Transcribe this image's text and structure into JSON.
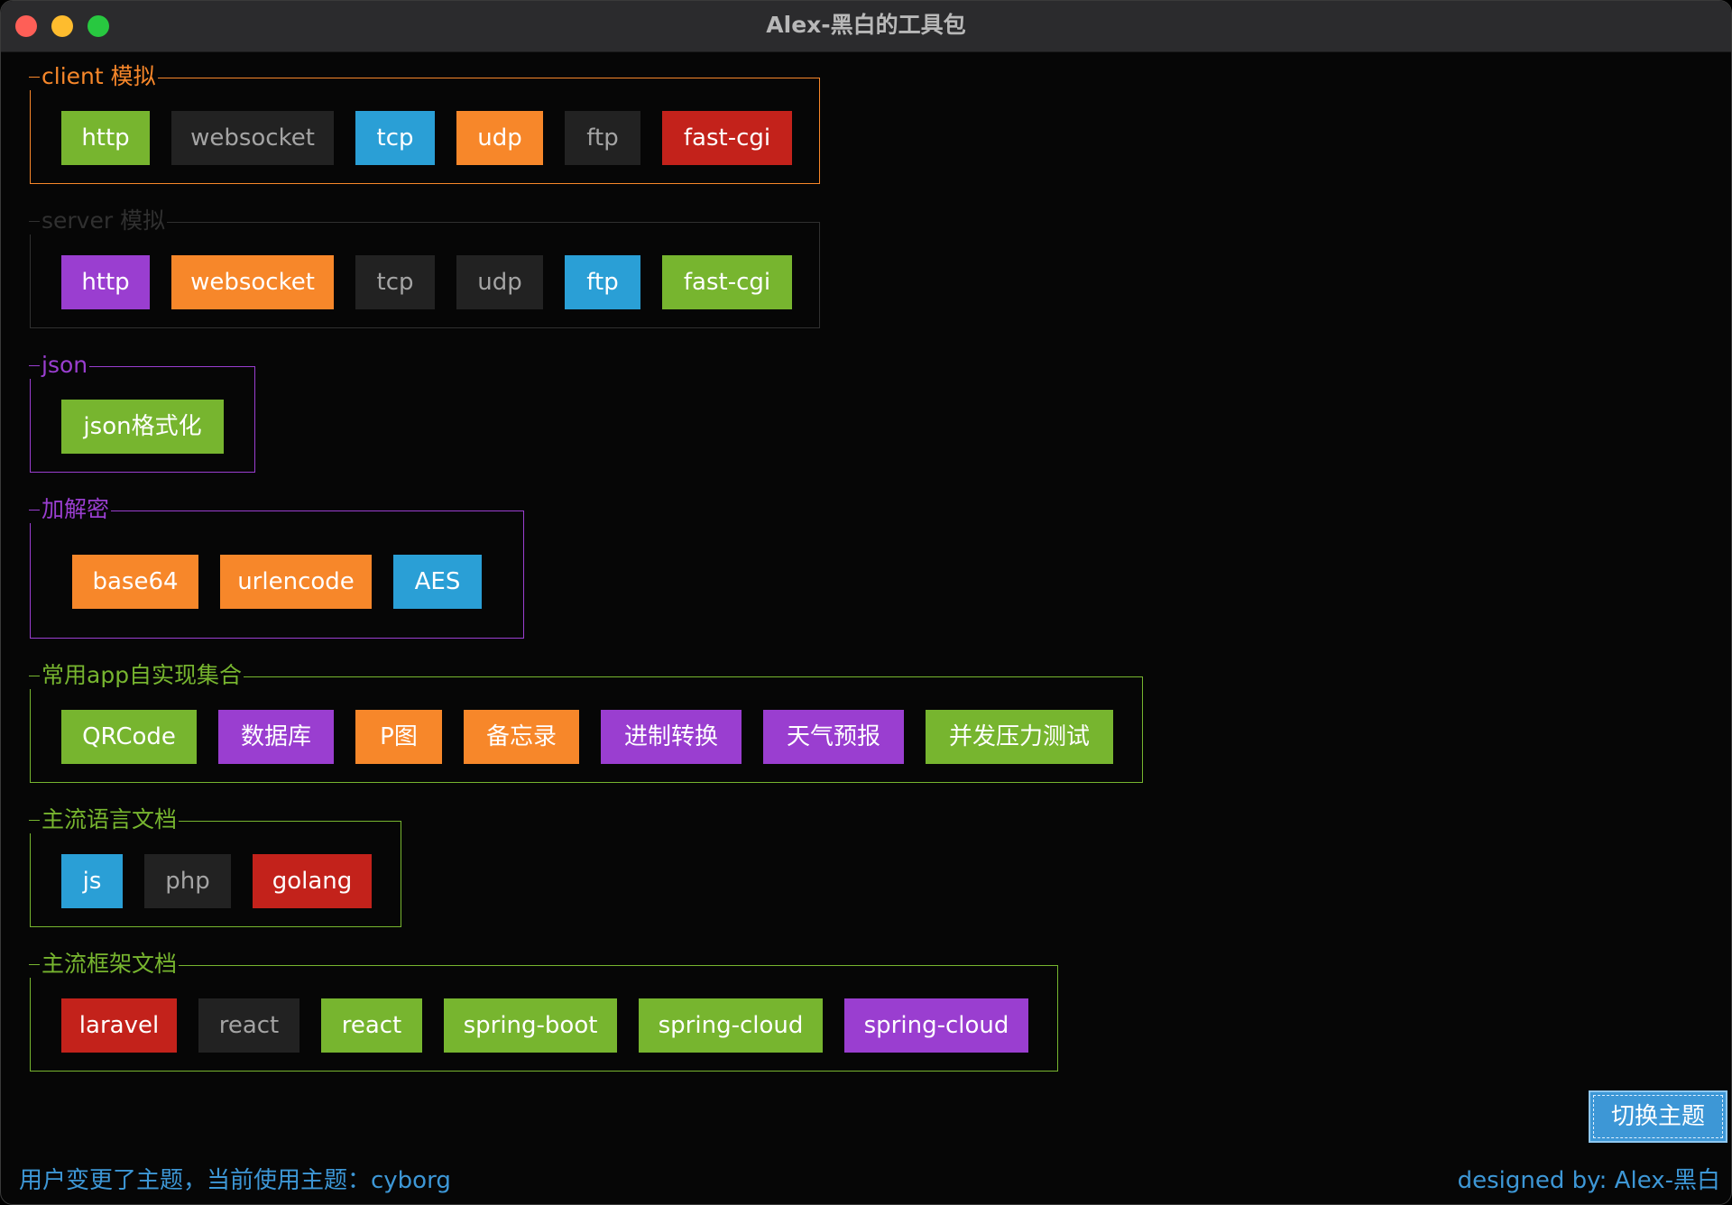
{
  "window": {
    "title": "Alex-黑白的工具包"
  },
  "groups": [
    {
      "label": "client 模拟",
      "color": "#f7872a",
      "buttons": [
        {
          "label": "http",
          "style": "green"
        },
        {
          "label": "websocket",
          "style": "gray"
        },
        {
          "label": "tcp",
          "style": "blue"
        },
        {
          "label": "udp",
          "style": "orange"
        },
        {
          "label": "ftp",
          "style": "gray"
        },
        {
          "label": "fast-cgi",
          "style": "red"
        }
      ]
    },
    {
      "label": "server 模拟",
      "color": "#303030",
      "buttons": [
        {
          "label": "http",
          "style": "purple"
        },
        {
          "label": "websocket",
          "style": "orange"
        },
        {
          "label": "tcp",
          "style": "gray"
        },
        {
          "label": "udp",
          "style": "gray"
        },
        {
          "label": "ftp",
          "style": "blue"
        },
        {
          "label": "fast-cgi",
          "style": "green"
        }
      ]
    },
    {
      "label": "json",
      "color": "#9a3ed0",
      "buttons": [
        {
          "label": "json格式化",
          "style": "green"
        }
      ]
    },
    {
      "label": "加解密",
      "color": "#9a3ed0",
      "buttons": [
        {
          "label": "base64",
          "style": "orange"
        },
        {
          "label": "urlencode",
          "style": "orange"
        },
        {
          "label": "AES",
          "style": "blue"
        }
      ]
    },
    {
      "label": "常用app自实现集合",
      "color": "#77b52f",
      "buttons": [
        {
          "label": "QRCode",
          "style": "green"
        },
        {
          "label": "数据库",
          "style": "purple"
        },
        {
          "label": "P图",
          "style": "orange"
        },
        {
          "label": "备忘录",
          "style": "orange"
        },
        {
          "label": "进制转换",
          "style": "purple"
        },
        {
          "label": "天气预报",
          "style": "purple"
        },
        {
          "label": "并发压力测试",
          "style": "green"
        }
      ]
    },
    {
      "label": "主流语言文档",
      "color": "#77b52f",
      "buttons": [
        {
          "label": "js",
          "style": "blue"
        },
        {
          "label": "php",
          "style": "gray"
        },
        {
          "label": "golang",
          "style": "red"
        }
      ]
    },
    {
      "label": "主流框架文档",
      "color": "#77b52f",
      "buttons": [
        {
          "label": "laravel",
          "style": "red"
        },
        {
          "label": "react",
          "style": "gray"
        },
        {
          "label": "react",
          "style": "green"
        },
        {
          "label": "spring-boot",
          "style": "green"
        },
        {
          "label": "spring-cloud",
          "style": "green"
        },
        {
          "label": "spring-cloud",
          "style": "purple"
        }
      ]
    }
  ],
  "theme_button": {
    "label": "切换主题"
  },
  "status": {
    "left": "用户变更了主题，当前使用主题：cyborg",
    "right": "designed by: Alex-黑白"
  },
  "colors": {
    "green": "#77b52f",
    "gray": "#222222",
    "blue": "#2a9fd6",
    "orange": "#f7872a",
    "red": "#c3221b",
    "purple": "#9a3ed0",
    "status_text": "#3d97d6"
  }
}
